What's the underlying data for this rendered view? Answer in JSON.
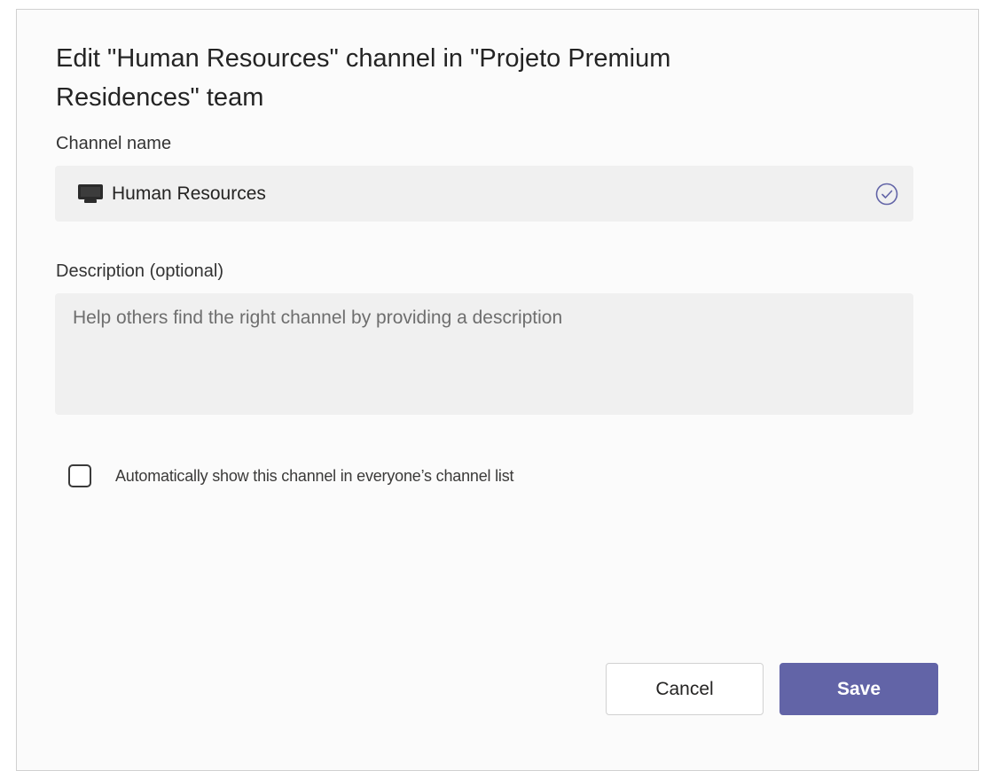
{
  "dialog": {
    "title": "Edit \"Human Resources\" channel in \"Projeto Premium Residences\" team",
    "channel_name_label": "Channel name",
    "channel_name_value": "Human Resources",
    "description_label": "Description (optional)",
    "description_placeholder": "Help others find the right channel by providing a description",
    "auto_show_label": "Automatically show this channel in everyone’s channel list",
    "auto_show_checked": false,
    "cancel_label": "Cancel",
    "save_label": "Save"
  },
  "icons": {
    "channel": "channel-icon",
    "valid": "check-circle-icon"
  },
  "colors": {
    "primary": "#6264a7",
    "field_bg": "#f0f0f0",
    "valid_check": "#6264a7"
  }
}
